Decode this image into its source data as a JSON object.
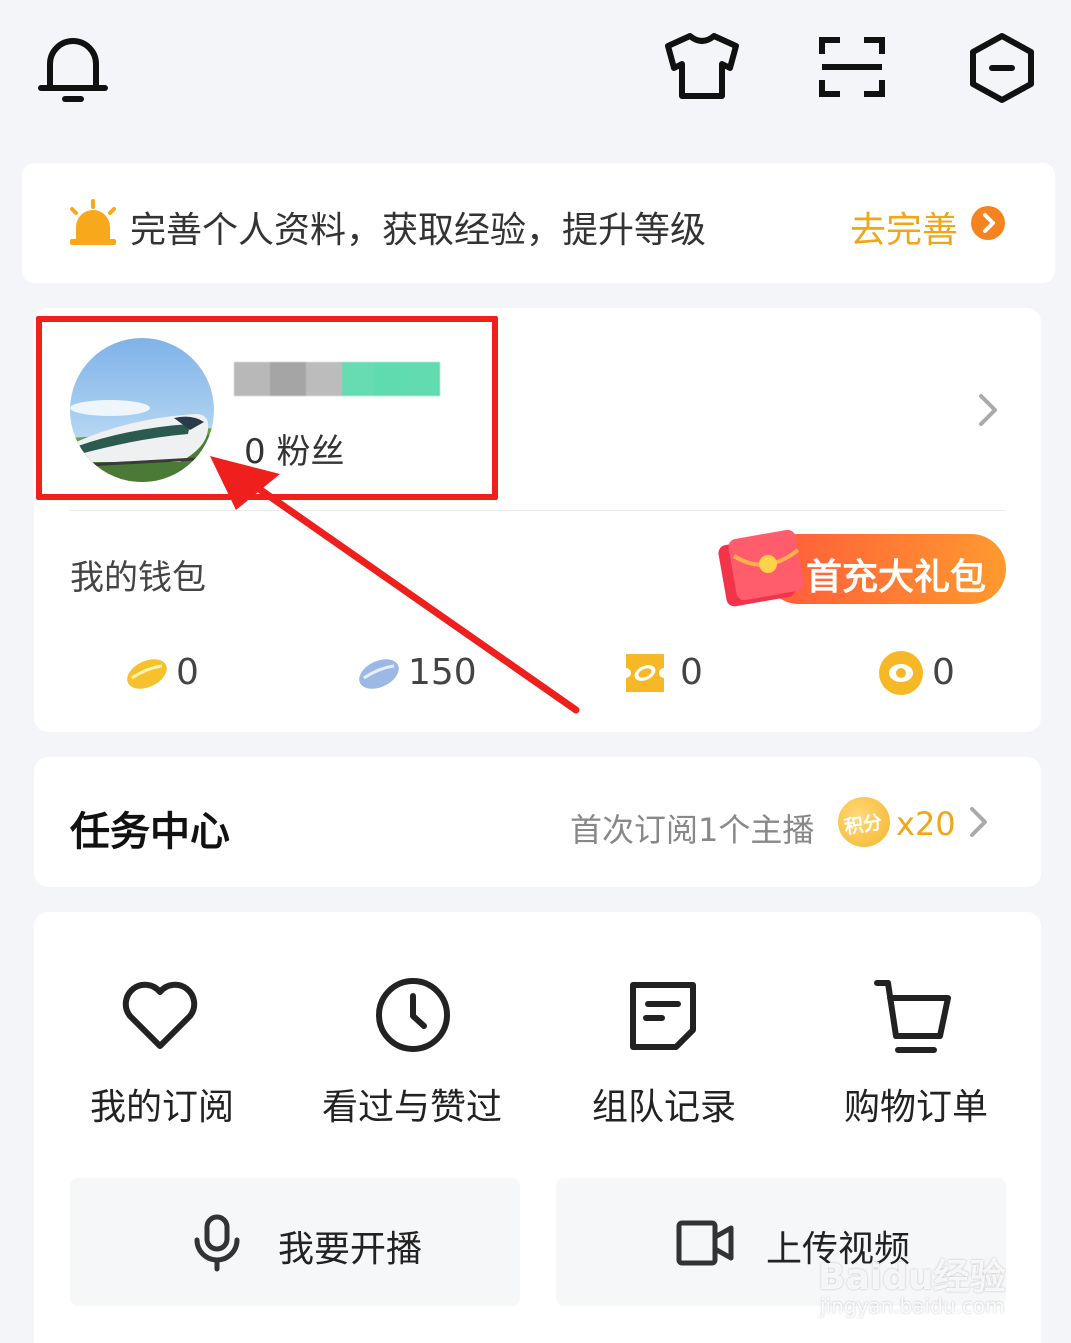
{
  "top_bar": {
    "icons": [
      "bell-icon",
      "tshirt-icon",
      "scan-icon",
      "settings-hexagon-icon"
    ]
  },
  "profile_banner": {
    "text": "完善个人资料，获取经验，提升等级",
    "action": "去完善",
    "accent": "#f5a318"
  },
  "profile": {
    "fans_count": "0",
    "fans_label": "粉丝"
  },
  "wallet": {
    "title": "我的钱包",
    "promo": "首充大礼包",
    "items": [
      {
        "icon": "gold-bean-icon",
        "value": "0"
      },
      {
        "icon": "silver-bean-icon",
        "value": "150"
      },
      {
        "icon": "ticket-icon",
        "value": "0"
      },
      {
        "icon": "coin-icon",
        "value": "0"
      }
    ]
  },
  "task_center": {
    "title": "任务中心",
    "task": "首次订阅1个主播",
    "badge": "积分",
    "reward": "x20"
  },
  "shortcuts": [
    {
      "icon": "heart-icon",
      "label": "我的订阅"
    },
    {
      "icon": "clock-icon",
      "label": "看过与赞过"
    },
    {
      "icon": "note-icon",
      "label": "组队记录"
    },
    {
      "icon": "cart-icon",
      "label": "购物订单"
    }
  ],
  "actions": {
    "live": "我要开播",
    "upload": "上传视频"
  },
  "watermark": {
    "brand": "Baidu经验",
    "url": "jingyan.baidu.com"
  }
}
